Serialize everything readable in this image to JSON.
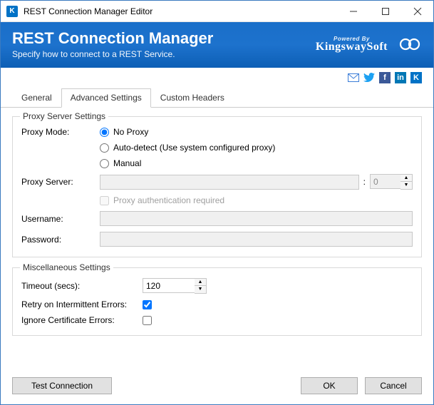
{
  "window": {
    "title": "REST Connection Manager Editor"
  },
  "banner": {
    "title": "REST Connection Manager",
    "subtitle": "Specify how to connect to a REST Service.",
    "powered_by": "Powered By",
    "brand": "KingswaySoft"
  },
  "social": {
    "mail": "mail-icon",
    "twitter": "twitter-icon",
    "facebook": "facebook-icon",
    "linkedin": "linkedin-icon",
    "k": "kingsway-icon"
  },
  "tabs": {
    "general": "General",
    "advanced": "Advanced Settings",
    "custom_headers": "Custom Headers",
    "active": "advanced"
  },
  "proxy": {
    "legend": "Proxy Server Settings",
    "mode_label": "Proxy Mode:",
    "options": {
      "no_proxy": "No Proxy",
      "auto": "Auto-detect (Use system configured proxy)",
      "manual": "Manual",
      "selected": "no_proxy"
    },
    "server_label": "Proxy Server:",
    "server_value": "",
    "port_value": "0",
    "auth_required_label": "Proxy authentication required",
    "auth_required_checked": false,
    "username_label": "Username:",
    "username_value": "",
    "password_label": "Password:",
    "password_value": ""
  },
  "misc": {
    "legend": "Miscellaneous Settings",
    "timeout_label": "Timeout (secs):",
    "timeout_value": "120",
    "retry_label": "Retry on Intermittent Errors:",
    "retry_checked": true,
    "ignore_cert_label": "Ignore Certificate Errors:",
    "ignore_cert_checked": false
  },
  "footer": {
    "test": "Test Connection",
    "ok": "OK",
    "cancel": "Cancel"
  }
}
